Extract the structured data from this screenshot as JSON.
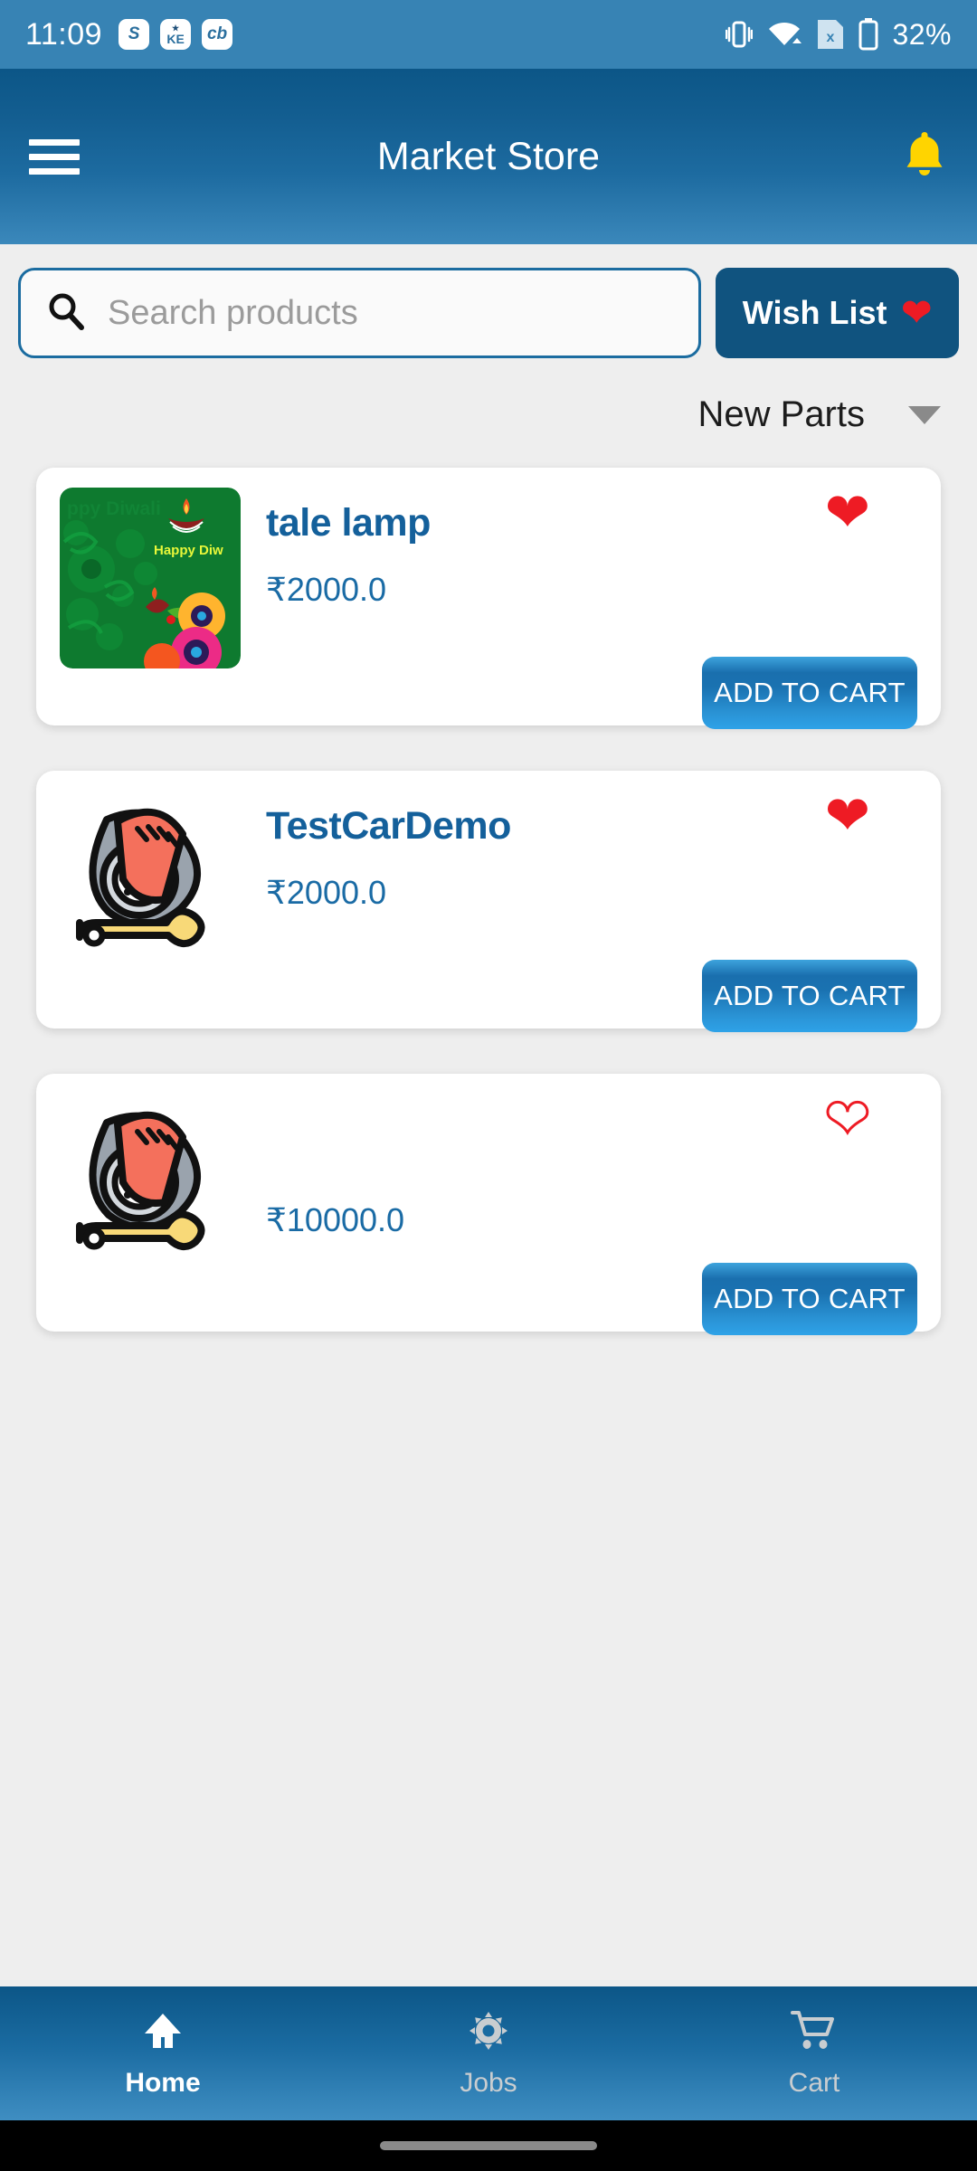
{
  "status_bar": {
    "time": "11:09",
    "battery_text": "32%",
    "notification_icons": [
      "skype-icon",
      "ke-app-icon",
      "cb-app-icon"
    ],
    "status_icons": [
      "vibrate-icon",
      "wifi-icon",
      "sim-card-x-icon",
      "battery-icon"
    ],
    "background_color": "#3783b4"
  },
  "app_bar": {
    "title": "Market Store",
    "menu_icon": "hamburger-menu-icon",
    "notification_icon": "bell-icon",
    "bell_color": "#ffd400"
  },
  "search": {
    "placeholder": "Search products",
    "value": "",
    "icon": "search-icon"
  },
  "wish_list": {
    "label": "Wish List",
    "icon": "heart-filled-icon",
    "background_color": "#10537f",
    "heart_color": "#ee1b24"
  },
  "sort": {
    "label": "New Parts",
    "icon": "chevron-down-icon"
  },
  "products": [
    {
      "name": "tale lamp",
      "price": "₹2000.0",
      "image": "diwali-greeting-image",
      "favorite": true,
      "cart_label": "ADD TO CART"
    },
    {
      "name": "TestCarDemo",
      "price": "₹2000.0",
      "image": "car-tire-wrench-image",
      "favorite": true,
      "cart_label": "ADD TO CART"
    },
    {
      "name": "",
      "price": "₹10000.0",
      "image": "car-tire-wrench-image",
      "favorite": false,
      "cart_label": "ADD TO CART"
    }
  ],
  "bottom_nav": {
    "items": [
      {
        "label": "Home",
        "icon": "home-icon",
        "active": true
      },
      {
        "label": "Jobs",
        "icon": "gear-icon",
        "active": false
      },
      {
        "label": "Cart",
        "icon": "shopping-cart-icon",
        "active": false
      }
    ]
  },
  "colors": {
    "accent_blue": "#14609b",
    "heart_red": "#ee1b24",
    "page_background": "#eeeeee",
    "card_background": "#ffffff"
  }
}
